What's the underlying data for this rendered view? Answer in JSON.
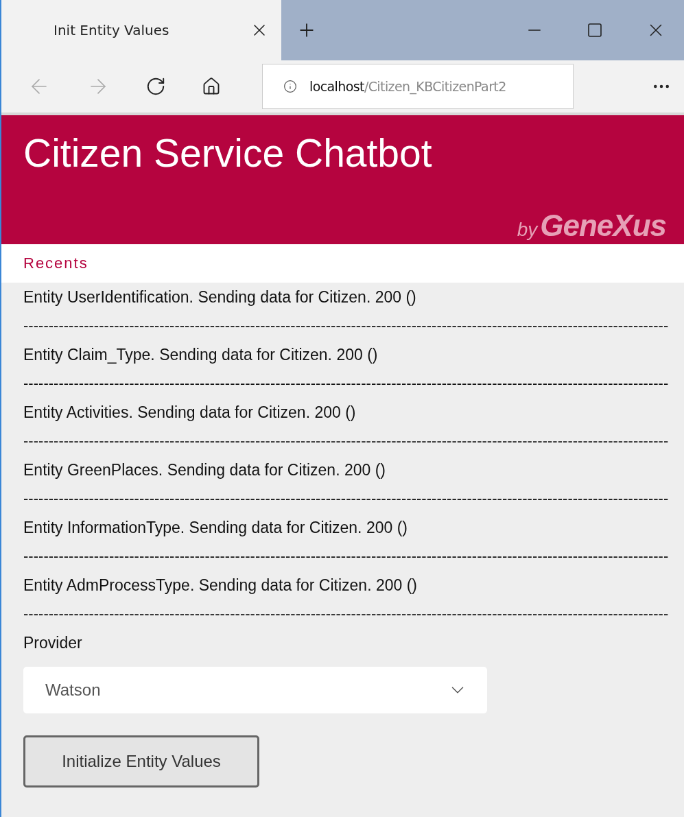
{
  "browser": {
    "tab": {
      "title": "Init Entity Values",
      "selected": true
    },
    "address": {
      "host": "localhost",
      "path": "/Citizen_KBCitizenPart2"
    }
  },
  "header": {
    "title": "Citizen Service Chatbot",
    "logo_by": "by",
    "logo_name": "GeneXus"
  },
  "recents": {
    "title": "Recents"
  },
  "log": [
    {
      "text": "Entity UserIdentification. Sending data for Citizen. 200 ()",
      "separator": "--------------------------------------------------------------------------------------------------------------------------------"
    },
    {
      "text": "Entity Claim_Type. Sending data for Citizen. 200 ()",
      "separator": "--------------------------------------------------------------------------------------------------------------------------------"
    },
    {
      "text": "Entity Activities. Sending data for Citizen. 200 ()",
      "separator": "--------------------------------------------------------------------------------------------------------------------------------"
    },
    {
      "text": "Entity GreenPlaces. Sending data for Citizen. 200 ()",
      "separator": "--------------------------------------------------------------------------------------------------------------------------------"
    },
    {
      "text": "Entity InformationType. Sending data for Citizen. 200 ()",
      "separator": "--------------------------------------------------------------------------------------------------------------------------------"
    },
    {
      "text": "Entity AdmProcessType. Sending data for Citizen. 200 ()",
      "separator": "--------------------------------------------------------------------------------------------------------------------------------"
    }
  ],
  "provider": {
    "label": "Provider",
    "value": "Watson"
  },
  "button": "Initialize Entity Values"
}
